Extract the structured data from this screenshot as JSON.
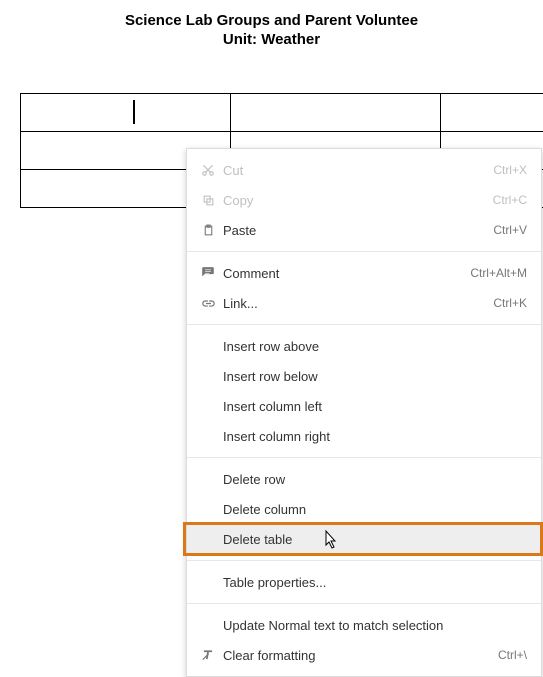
{
  "title_line1": "Science Lab Groups and Parent Voluntee",
  "title_line2": "Unit: Weather",
  "menu": {
    "cut": {
      "label": "Cut",
      "shortcut": "Ctrl+X"
    },
    "copy": {
      "label": "Copy",
      "shortcut": "Ctrl+C"
    },
    "paste": {
      "label": "Paste",
      "shortcut": "Ctrl+V"
    },
    "comment": {
      "label": "Comment",
      "shortcut": "Ctrl+Alt+M"
    },
    "link": {
      "label": "Link...",
      "shortcut": "Ctrl+K"
    },
    "insert_row_above": {
      "label": "Insert row above"
    },
    "insert_row_below": {
      "label": "Insert row below"
    },
    "insert_col_left": {
      "label": "Insert column left"
    },
    "insert_col_right": {
      "label": "Insert column right"
    },
    "delete_row": {
      "label": "Delete row"
    },
    "delete_column": {
      "label": "Delete column"
    },
    "delete_table": {
      "label": "Delete table"
    },
    "table_properties": {
      "label": "Table properties..."
    },
    "update_normal": {
      "label": "Update Normal text to match selection"
    },
    "clear_formatting": {
      "label": "Clear formatting",
      "shortcut": "Ctrl+\\"
    }
  }
}
